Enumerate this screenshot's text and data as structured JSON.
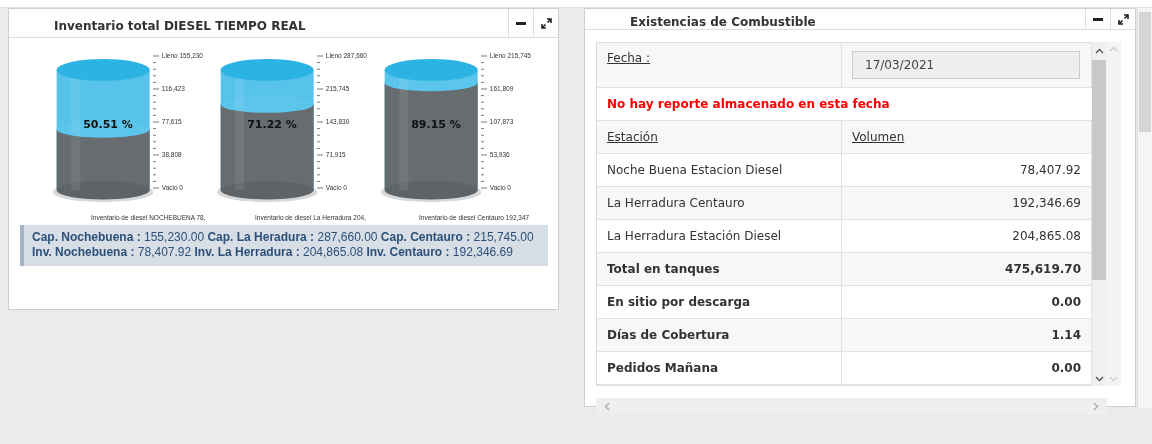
{
  "inventory_panel": {
    "title": "Inventario total DIESEL TIEMPO REAL",
    "tanks": [
      {
        "percent": "50.51 %",
        "level": 0.5051,
        "scale": [
          "Lleno 155,230",
          "116,423",
          "77,615",
          "38,808",
          "Vacio 0"
        ],
        "caption": "Inventario de diesel NOCHEBUENA 78,"
      },
      {
        "percent": "71.22 %",
        "level": 0.7122,
        "scale": [
          "Lleno 287,660",
          "215,745",
          "143,830",
          "71,915",
          "Vacio 0"
        ],
        "caption": "Inventario de diesel La Herradura 204,"
      },
      {
        "percent": "89.15 %",
        "level": 0.8915,
        "scale": [
          "Lleno 215,745",
          "161,809",
          "107,873",
          "53,936",
          "Vacio 0"
        ],
        "caption": "Inventario de diesel Centauro 192,347"
      }
    ],
    "summary": [
      "**Cap. Nochebuena :** 155,230.00 **Cap. La Heradura :** 287,660.00 **Cap. Centauro :** 215,745.00",
      "**Inv. Nochebuena :** 78,407.92 **Inv. La Herradura :** 204,865.08 **Inv. Centauro :** 192,346.69"
    ]
  },
  "stock_panel": {
    "title": "Existencias de Combustible",
    "date_label": "Fecha :",
    "date_value": "17/03/2021",
    "message": "No hay reporte almacenado en esta fecha",
    "columns": [
      "Estación",
      "Volumen"
    ],
    "rows": [
      {
        "kind": "station",
        "station": "Noche Buena Estacion Diesel",
        "volume": "78,407.92"
      },
      {
        "kind": "station",
        "station": "La Herradura Centauro",
        "volume": "192,346.69"
      },
      {
        "kind": "station",
        "station": "La Herradura Estación Diesel",
        "volume": "204,865.08"
      },
      {
        "kind": "total",
        "station": "Total en tanques",
        "volume": "475,619.70"
      },
      {
        "kind": "total",
        "station": "En sitio por descarga",
        "volume": "0.00"
      },
      {
        "kind": "total",
        "station": "Días de Cobertura",
        "volume": "1.14"
      },
      {
        "kind": "total",
        "station": "Pedidos Mañana",
        "volume": "0.00"
      }
    ]
  }
}
